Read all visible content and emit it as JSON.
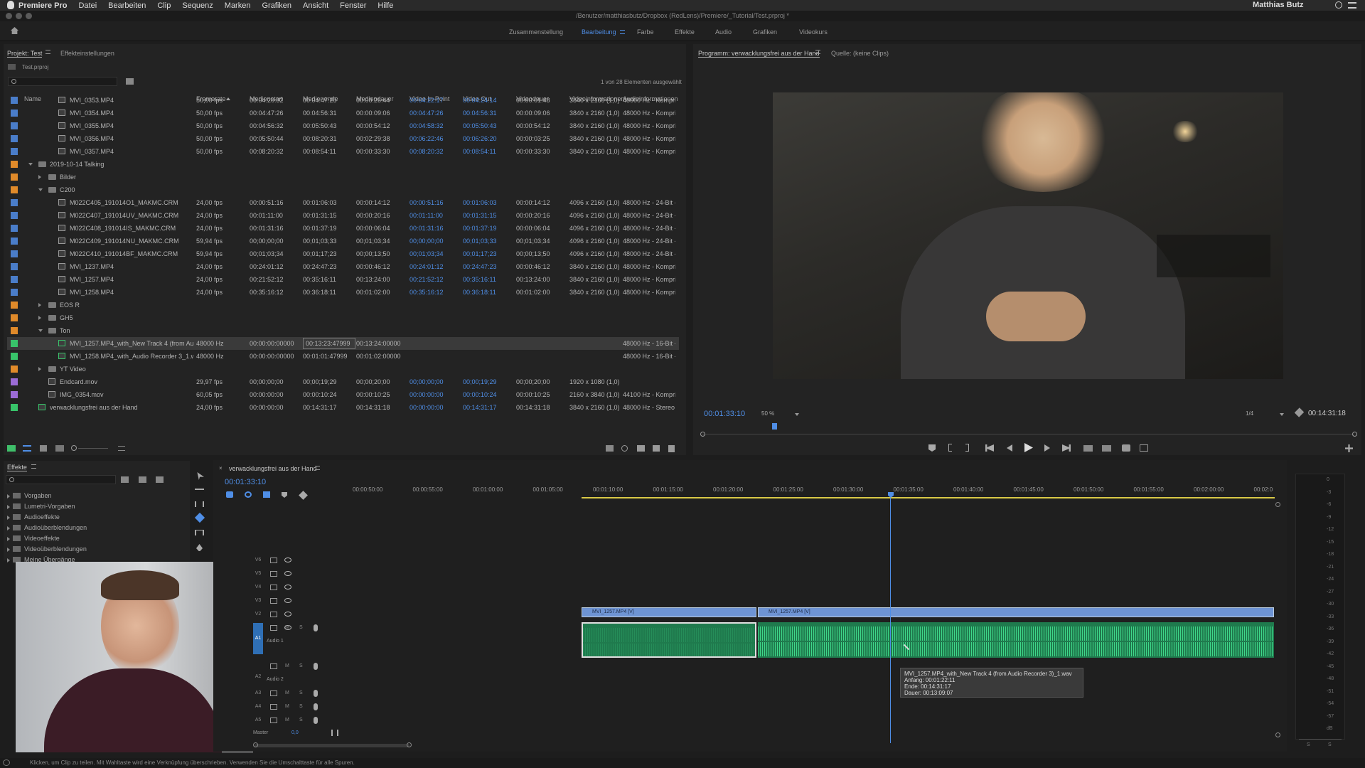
{
  "menubar": {
    "app": "Premiere Pro",
    "items": [
      "Datei",
      "Bearbeiten",
      "Clip",
      "Sequenz",
      "Marken",
      "Grafiken",
      "Ansicht",
      "Fenster",
      "Hilfe"
    ],
    "user": "Matthias Butz"
  },
  "titlebar": {
    "path": "/Benutzer/matthiasbutz/Dropbox (RedLens)/Premiere/_Tutorial/Test.prproj *"
  },
  "workspaces": {
    "tabs": [
      "Zusammenstellung",
      "Bearbeitung",
      "Farbe",
      "Effekte",
      "Audio",
      "Grafiken",
      "Videokurs"
    ],
    "active": "Bearbeitung"
  },
  "project": {
    "tab_project": "Projekt: Test",
    "tab_effects": "Effekteinstellungen",
    "filename": "Test.prproj",
    "selection_info": "1 von 28 Elementen ausgewählt",
    "columns": [
      "Name",
      "Framerate",
      "Medienstart",
      "Medienende",
      "Mediendauer",
      "Video In-Point",
      "Video Out",
      "Videodauer",
      "Videoinformationen",
      "Audioinformationen"
    ],
    "rows": [
      {
        "type": "clip",
        "depth": 2,
        "color": "#4a7dc9",
        "name": "MVI_0353.MP4",
        "fps": "50,00 fps",
        "start": "00:04:20:32",
        "end": "00:04:47:25",
        "dur": "00:00:26:44",
        "in": "00:04:22:17",
        "out": "00:04:24:14",
        "vdur": "00:00:01:48",
        "vinfo": "3840 x 2160 (1,0)",
        "ainfo": "48000 Hz - Kompri"
      },
      {
        "type": "clip",
        "depth": 2,
        "color": "#4a7dc9",
        "name": "MVI_0354.MP4",
        "fps": "50,00 fps",
        "start": "00:04:47:26",
        "end": "00:04:56:31",
        "dur": "00:00:09:06",
        "in": "00:04:47:26",
        "out": "00:04:56:31",
        "vdur": "00:00:09:06",
        "vinfo": "3840 x 2160 (1,0)",
        "ainfo": "48000 Hz - Kompri"
      },
      {
        "type": "clip",
        "depth": 2,
        "color": "#4a7dc9",
        "name": "MVI_0355.MP4",
        "fps": "50,00 fps",
        "start": "00:04:56:32",
        "end": "00:05:50:43",
        "dur": "00:00:54:12",
        "in": "00:04:58:32",
        "out": "00:05:50:43",
        "vdur": "00:00:54:12",
        "vinfo": "3840 x 2160 (1,0)",
        "ainfo": "48000 Hz - Kompri"
      },
      {
        "type": "clip",
        "depth": 2,
        "color": "#4a7dc9",
        "name": "MVI_0356.MP4",
        "fps": "50,00 fps",
        "start": "00:05:50:44",
        "end": "00:08:20:31",
        "dur": "00:02:29:38",
        "in": "00:06:22:46",
        "out": "00:06:26:20",
        "vdur": "00:00:03:25",
        "vinfo": "3840 x 2160 (1,0)",
        "ainfo": "48000 Hz - Kompri"
      },
      {
        "type": "clip",
        "depth": 2,
        "color": "#4a7dc9",
        "name": "MVI_0357.MP4",
        "fps": "50,00 fps",
        "start": "00:08:20:32",
        "end": "00:08:54:11",
        "dur": "00:00:33:30",
        "in": "00:08:20:32",
        "out": "00:08:54:11",
        "vdur": "00:00:33:30",
        "vinfo": "3840 x 2160 (1,0)",
        "ainfo": "48000 Hz - Kompri"
      },
      {
        "type": "folder",
        "depth": 0,
        "open": true,
        "color": "#e08a2a",
        "name": "2019-10-14 Talking"
      },
      {
        "type": "folder",
        "depth": 1,
        "open": false,
        "color": "#e08a2a",
        "name": "Bilder"
      },
      {
        "type": "folder",
        "depth": 1,
        "open": true,
        "color": "#e08a2a",
        "name": "C200"
      },
      {
        "type": "clip",
        "depth": 2,
        "color": "#4a7dc9",
        "name": "M022C405_191014O1_MAKMC.CRM",
        "fps": "24,00 fps",
        "start": "00:00:51:16",
        "end": "00:01:06:03",
        "dur": "00:00:14:12",
        "in": "00:00:51:16",
        "out": "00:01:06:03",
        "vdur": "00:00:14:12",
        "vinfo": "4096 x 2160 (1,0)",
        "ainfo": "48000 Hz - 24-Bit - 4"
      },
      {
        "type": "clip",
        "depth": 2,
        "color": "#4a7dc9",
        "name": "M022C407_191014UV_MAKMC.CRM",
        "fps": "24,00 fps",
        "start": "00:01:11:00",
        "end": "00:01:31:15",
        "dur": "00:00:20:16",
        "in": "00:01:11:00",
        "out": "00:01:31:15",
        "vdur": "00:00:20:16",
        "vinfo": "4096 x 2160 (1,0)",
        "ainfo": "48000 Hz - 24-Bit - 4"
      },
      {
        "type": "clip",
        "depth": 2,
        "color": "#4a7dc9",
        "name": "M022C408_191014IS_MAKMC.CRM",
        "fps": "24,00 fps",
        "start": "00:01:31:16",
        "end": "00:01:37:19",
        "dur": "00:00:06:04",
        "in": "00:01:31:16",
        "out": "00:01:37:19",
        "vdur": "00:00:06:04",
        "vinfo": "4096 x 2160 (1,0)",
        "ainfo": "48000 Hz - 24-Bit - 4"
      },
      {
        "type": "clip",
        "depth": 2,
        "color": "#4a7dc9",
        "name": "M022C409_191014NU_MAKMC.CRM",
        "fps": "59,94 fps",
        "start": "00;00;00;00",
        "end": "00;01;03;33",
        "dur": "00;01;03;34",
        "in": "00;00;00;00",
        "out": "00;01;03;33",
        "vdur": "00;01;03;34",
        "vinfo": "4096 x 2160 (1,0)",
        "ainfo": "48000 Hz - 24-Bit - 4"
      },
      {
        "type": "clip",
        "depth": 2,
        "color": "#4a7dc9",
        "name": "M022C410_191014BF_MAKMC.CRM",
        "fps": "59,94 fps",
        "start": "00;01;03;34",
        "end": "00;01;17;23",
        "dur": "00;00;13;50",
        "in": "00;01;03;34",
        "out": "00;01;17;23",
        "vdur": "00;00;13;50",
        "vinfo": "4096 x 2160 (1,0)",
        "ainfo": "48000 Hz - 24-Bit - 4"
      },
      {
        "type": "clip",
        "depth": 2,
        "color": "#4a7dc9",
        "name": "MVI_1237.MP4",
        "fps": "24,00 fps",
        "start": "00:24:01:12",
        "end": "00:24:47:23",
        "dur": "00:00:46:12",
        "in": "00:24:01:12",
        "out": "00:24:47:23",
        "vdur": "00:00:46:12",
        "vinfo": "3840 x 2160 (1,0)",
        "ainfo": "48000 Hz - Kompri"
      },
      {
        "type": "clip",
        "depth": 2,
        "color": "#4a7dc9",
        "name": "MVI_1257.MP4",
        "fps": "24,00 fps",
        "start": "00:21:52:12",
        "end": "00:35:16:11",
        "dur": "00:13:24:00",
        "in": "00:21:52:12",
        "out": "00:35:16:11",
        "vdur": "00:13:24:00",
        "vinfo": "3840 x 2160 (1,0)",
        "ainfo": "48000 Hz - Kompri"
      },
      {
        "type": "clip",
        "depth": 2,
        "color": "#4a7dc9",
        "name": "MVI_1258.MP4",
        "fps": "24,00 fps",
        "start": "00:35:16:12",
        "end": "00:36:18:11",
        "dur": "00:01:02:00",
        "in": "00:35:16:12",
        "out": "00:36:18:11",
        "vdur": "00:01:02:00",
        "vinfo": "3840 x 2160 (1,0)",
        "ainfo": "48000 Hz - Kompri"
      },
      {
        "type": "folder",
        "depth": 1,
        "open": false,
        "color": "#e08a2a",
        "name": "EOS R"
      },
      {
        "type": "folder",
        "depth": 1,
        "open": false,
        "color": "#e08a2a",
        "name": "GH5"
      },
      {
        "type": "folder",
        "depth": 1,
        "open": true,
        "color": "#e08a2a",
        "name": "Ton"
      },
      {
        "type": "audio",
        "depth": 2,
        "color": "#38c46a",
        "selected": true,
        "name": "MVI_1257.MP4_with_New Track 4 (from Au",
        "fps": "48000  Hz",
        "start": "00:00:00:00000",
        "end": "00:13:23:47999",
        "dur": "00:13:24:00000",
        "in": "",
        "out": "",
        "vdur": "",
        "vinfo": "",
        "ainfo": "48000 Hz - 16-Bit - S"
      },
      {
        "type": "audio",
        "depth": 2,
        "color": "#38c46a",
        "name": "MVI_1258.MP4_with_Audio Recorder 3_1.w",
        "fps": "48000  Hz",
        "start": "00:00:00:00000",
        "end": "00:01:01:47999",
        "dur": "00:01:02:00000",
        "in": "",
        "out": "",
        "vdur": "",
        "vinfo": "",
        "ainfo": "48000 Hz - 16-Bit - S"
      },
      {
        "type": "folder",
        "depth": 1,
        "open": false,
        "color": "#e08a2a",
        "name": "YT Video"
      },
      {
        "type": "clip",
        "depth": 1,
        "color": "#9b6bd6",
        "name": "Endcard.mov",
        "fps": "29,97 fps",
        "start": "00;00;00;00",
        "end": "00;00;19;29",
        "dur": "00;00;20;00",
        "in": "00;00;00;00",
        "out": "00;00;19;29",
        "vdur": "00;00;20;00",
        "vinfo": "1920 x 1080 (1,0)",
        "ainfo": ""
      },
      {
        "type": "clip",
        "depth": 1,
        "color": "#9b6bd6",
        "name": "IMG_0354.mov",
        "fps": "60,05 fps",
        "start": "00:00:00:00",
        "end": "00:00:10:24",
        "dur": "00:00:10:25",
        "in": "00:00:00:00",
        "out": "00:00:10:24",
        "vdur": "00:00:10:25",
        "vinfo": "2160 x 3840 (1,0)",
        "ainfo": "44100 Hz - Kompri"
      },
      {
        "type": "seq",
        "depth": 0,
        "color": "#38c46a",
        "name": "verwacklungsfrei aus der Hand",
        "fps": "24,00 fps",
        "start": "00:00:00:00",
        "end": "00:14:31:17",
        "dur": "00:14:31:18",
        "in": "00:00:00:00",
        "out": "00:14:31:17",
        "vdur": "00:14:31:18",
        "vinfo": "3840 x 2160 (1,0)",
        "ainfo": "48000 Hz - Stereo"
      }
    ]
  },
  "program": {
    "tab": "Programm: verwacklungsfrei aus der Hand",
    "source_tab": "Quelle: (keine Clips)",
    "timecode": "00:01:33:10",
    "zoom": "50 %",
    "resolution": "1/4",
    "duration": "00:14:31:18",
    "playhead_fraction": 0.107
  },
  "effects": {
    "tab": "Effekte",
    "items": [
      "Vorgaben",
      "Lumetri-Vorgaben",
      "Audioeffekte",
      "Audioüberblendungen",
      "Videoeffekte",
      "Videoüberblendungen",
      "Meine Übergänge"
    ]
  },
  "sequence": {
    "tab": "verwacklungsfrei aus der Hand",
    "timecode": "00:01:33:10",
    "ruler": [
      "00:00:50:00",
      "00:00:55:00",
      "00:01:00:00",
      "00:01:05:00",
      "00:01:10:00",
      "00:01:15:00",
      "00:01:20:00",
      "00:01:25:00",
      "00:01:30:00",
      "00:01:35:00",
      "00:01:40:00",
      "00:01:45:00",
      "00:01:50:00",
      "00:01:55:00",
      "00:02:00:00",
      "00:02:0"
    ],
    "video_tracks": [
      "V6",
      "V5",
      "V4",
      "V3",
      "V2",
      "V1"
    ],
    "audio_tracks": [
      {
        "name": "A1",
        "label": "Audio 1"
      },
      {
        "name": "A2",
        "label": "Audio 2"
      },
      {
        "name": "A3",
        "label": ""
      },
      {
        "name": "A4",
        "label": ""
      },
      {
        "name": "A5",
        "label": ""
      }
    ],
    "master_label": "Master",
    "master_value": "0,0",
    "clip_v1": "MVI_1257.MP4 [V]",
    "clip_v2": "MVI_1257.MP4 [V]",
    "tooltip": {
      "name": "MVI_1257.MP4_with_New Track 4 (from Audio Recorder 3)_1.wav",
      "start": "Anfang: 00:01:22:11",
      "end": "Ende: 00:14:31:17",
      "dur": "Dauer: 00:13:09:07"
    }
  },
  "meter": {
    "ticks": [
      "0",
      "-3",
      "-6",
      "-9",
      "-12",
      "-15",
      "-18",
      "-21",
      "-24",
      "-27",
      "-30",
      "-33",
      "-36",
      "-39",
      "-42",
      "-45",
      "-48",
      "-51",
      "-54",
      "-57",
      "dB"
    ],
    "labels": [
      "S",
      "S"
    ]
  },
  "status": "Klicken, um Clip zu teilen. Mit Wahltaste wird eine Verknüpfung überschrieben. Verwenden Sie die Umschalttaste für alle Spuren."
}
